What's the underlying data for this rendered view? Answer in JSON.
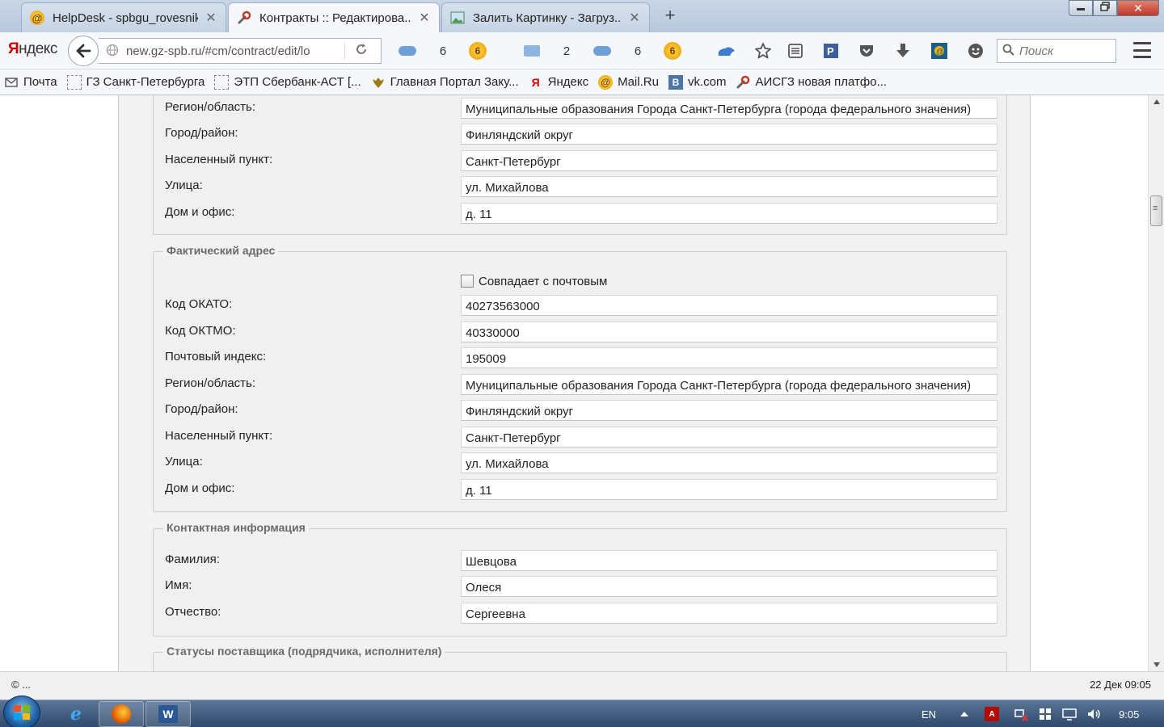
{
  "browser": {
    "tabs": [
      {
        "label": "HelpDesk - spbgu_rovesnik...",
        "icon": "helpdesk-icon",
        "active": false
      },
      {
        "label": "Контракты :: Редактирова...",
        "icon": "tools-icon",
        "active": true
      },
      {
        "label": "Залить Картинку - Загруз...",
        "icon": "image-host-icon",
        "active": false
      }
    ],
    "tab_close_glyph": "✕",
    "new_tab_glyph": "+",
    "brand_first": "Я",
    "brand_rest": "ндекс",
    "url": "new.gz-spb.ru/#cm/contract/edit/lo",
    "toolbar_counts": {
      "cloud1": "6",
      "mail": "2",
      "cloud2": "6"
    },
    "coin_label": "6",
    "search_placeholder": "Поиск"
  },
  "bookmarks": [
    {
      "label": "Почта",
      "icon": "mail-icon"
    },
    {
      "label": "ГЗ Санкт-Петербурга",
      "icon": "page-icon"
    },
    {
      "label": "ЭТП Сбербанк-АСТ [...",
      "icon": "page-icon"
    },
    {
      "label": "Главная Портал Заку...",
      "icon": "emblem-icon"
    },
    {
      "label": "Яндекс",
      "icon": "yandex-icon"
    },
    {
      "label": "Mail.Ru",
      "icon": "mailru-icon"
    },
    {
      "label": "vk.com",
      "icon": "vk-icon"
    },
    {
      "label": "АИСГЗ новая платфо...",
      "icon": "tools-icon"
    }
  ],
  "bookmark_glyphs": {
    "ya": "Я",
    "vk": "B",
    "mailru": "@"
  },
  "postal_tail": {
    "rows": [
      {
        "label": "Регион/область:",
        "value": "Муниципальные образования Города Санкт-Петербурга (города федерального значения)"
      },
      {
        "label": "Город/район:",
        "value": "Финляндский округ"
      },
      {
        "label": "Населенный пункт:",
        "value": "Санкт-Петербург"
      },
      {
        "label": "Улица:",
        "value": "ул. Михайлова"
      },
      {
        "label": "Дом и офис:",
        "value": "д. 11"
      }
    ]
  },
  "actual_address": {
    "legend": "Фактический адрес",
    "checkbox_label": "Совпадает с почтовым",
    "checkbox_checked": false,
    "rows": [
      {
        "label": "Код ОКАТО:",
        "value": "40273563000"
      },
      {
        "label": "Код ОКТМО:",
        "value": "40330000"
      },
      {
        "label": "Почтовый индекс:",
        "value": "195009"
      },
      {
        "label": "Регион/область:",
        "value": "Муниципальные образования Города Санкт-Петербурга (города федерального значения)"
      },
      {
        "label": "Город/район:",
        "value": "Финляндский округ"
      },
      {
        "label": "Населенный пункт:",
        "value": "Санкт-Петербург"
      },
      {
        "label": "Улица:",
        "value": "ул. Михайлова"
      },
      {
        "label": "Дом и офис:",
        "value": "д. 11"
      }
    ]
  },
  "contact_info": {
    "legend": "Контактная информация",
    "rows": [
      {
        "label": "Фамилия:",
        "value": "Шевцова"
      },
      {
        "label": "Имя:",
        "value": "Олеся"
      },
      {
        "label": "Отчество:",
        "value": "Сергеевна"
      }
    ]
  },
  "supplier_statuses": {
    "legend": "Статусы поставщика (подрядчика, исполнителя)"
  },
  "statusbar": {
    "left": "© ...",
    "right": "22 Дек 09:05"
  },
  "taskbar": {
    "lang": "EN",
    "clock": "9:05",
    "ie_glyph": "e",
    "word_glyph": "W",
    "pdf_glyph": "A"
  },
  "colors": {
    "legend_text": "#6a6a6a",
    "field_bg": "#ffffff",
    "panel_bg": "#f2f2f2",
    "brand_red": "#cc0000"
  }
}
